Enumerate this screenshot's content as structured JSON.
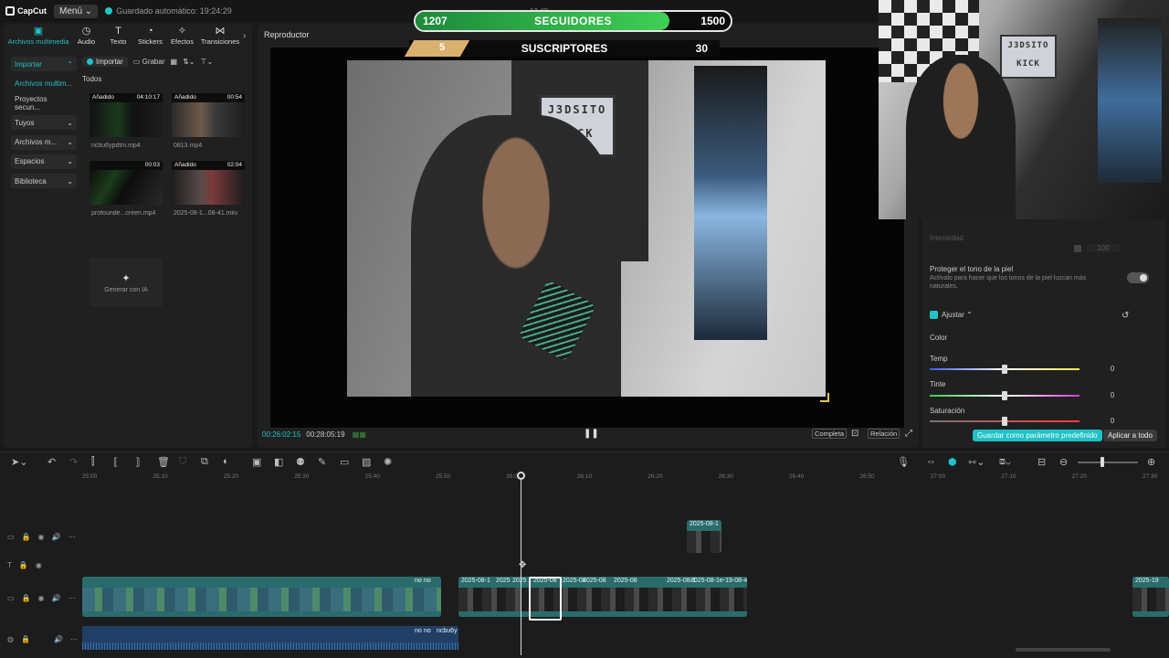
{
  "topbar": {
    "logo": "CapCut",
    "menu": "Menú",
    "autosave": "Guardado automático: 19:24:29",
    "center": "13 (2)"
  },
  "media_tabs": [
    {
      "label": "Archivos multimedia",
      "icon": "media-icon"
    },
    {
      "label": "Audio",
      "icon": "audio-icon"
    },
    {
      "label": "Texto",
      "icon": "text-icon"
    },
    {
      "label": "Stickers",
      "icon": "sticker-icon"
    },
    {
      "label": "Efectos",
      "icon": "effects-icon"
    },
    {
      "label": "Transiciones",
      "icon": "transitions-icon"
    }
  ],
  "side_nav": [
    "Importar",
    "Archivos multim...",
    "Proyectos secun...",
    "Tuyos",
    "Archivos m...",
    "Espacios",
    "Biblioteca"
  ],
  "media_toolbar": {
    "import": "Importar",
    "record": "Grabar",
    "all": "Todos"
  },
  "media_items": [
    {
      "badge": "Añadido",
      "duration": "04:10:17",
      "name": "ncbu6ypdtm.mp4"
    },
    {
      "badge": "Añadido",
      "duration": "00:54",
      "name": "0813.mp4"
    },
    {
      "badge": "",
      "duration": "00:03",
      "name": "profounde...creen.mp4"
    },
    {
      "badge": "Añadido",
      "duration": "02:04",
      "name": "2025-08-1...08-41.mkv"
    }
  ],
  "ai_card": "Generar con IA",
  "player": {
    "title": "Reproductor",
    "current_time": "00:26:02:15",
    "total_time": "00:28:05:19",
    "btn_complete": "Completa",
    "btn_ratio": "Relación"
  },
  "overlay": {
    "followers": {
      "current": "1207",
      "label": "SEGUIDORES",
      "goal": "1500",
      "fraction": 0.805
    },
    "subscribers": {
      "current": "5",
      "label": "SUSCRIPTORES",
      "goal": "30",
      "fraction": 0.18
    },
    "video_sign": [
      "J3DSITO",
      "KICK"
    ],
    "webcam_sign": [
      "J3DSITO",
      "KICK"
    ]
  },
  "right_panel": {
    "intensity_label": "Intensidad",
    "intensity_value": "100",
    "skin_title": "Proteger el tono de la piel",
    "skin_desc": "Actívalo para hacer que los tonos de la piel luzcan más naturales.",
    "adjust": "Ajustar",
    "color": "Color",
    "temp": {
      "label": "Temp",
      "value": "0"
    },
    "tint": {
      "label": "Tinte",
      "value": "0"
    },
    "saturation": {
      "label": "Saturación",
      "value": "0"
    },
    "save_preset": "Guardar como parámetro predefinido",
    "apply_all": "Aplicar a todo"
  },
  "ruler_ticks": [
    "25:00",
    "25:10",
    "25:20",
    "25:30",
    "25:40",
    "25:50",
    "26:00",
    "26:10",
    "26:20",
    "26:30",
    "26:40",
    "26:50",
    "27:00",
    "27:10",
    "27:20",
    "27:30"
  ],
  "clips": {
    "overlay_clip": "2025-08-1",
    "main_labels": [
      "no",
      "no",
      "2025-08-1",
      "2025",
      "2025",
      "2025-08",
      "2025-08",
      "2025-08",
      "2025-08",
      "2025-08-1",
      "2025-08-1e-19-08-4",
      "2025-19"
    ],
    "audio_labels": [
      "no",
      "no",
      "ncbu6y"
    ]
  },
  "colors": {
    "accent": "#1fc2c6",
    "panel": "#202020",
    "bg": "#1a1a1a"
  }
}
